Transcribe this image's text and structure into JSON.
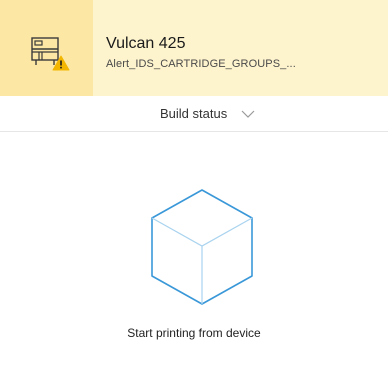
{
  "device": {
    "name": "Vulcan 425",
    "status": "Alert_IDS_CARTRIDGE_GROUPS_..."
  },
  "build_status": {
    "label": "Build status"
  },
  "empty_state": {
    "message": "Start printing from device"
  },
  "icons": {
    "device": "printer-icon",
    "alert": "warning-icon",
    "dropdown": "chevron-down-icon",
    "placeholder": "cube-icon"
  },
  "colors": {
    "header_background": "#fdf3cc",
    "icon_tile_background": "#fce8a4",
    "warning": "#f2b600",
    "cube_stroke": "#3a98d8",
    "cube_inner": "#a9d3ef"
  }
}
